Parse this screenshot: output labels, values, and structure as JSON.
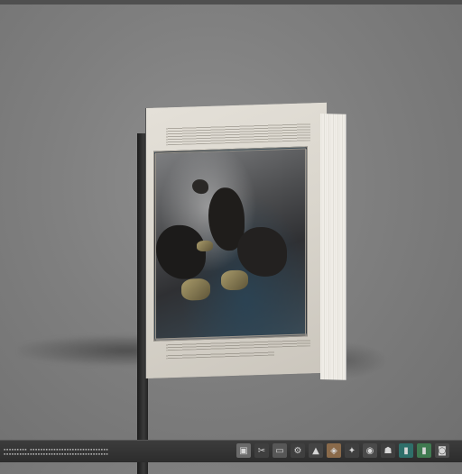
{
  "taskbar": {
    "status_line_1": "▪▪▪▪▪▪▪▪▪ ▪▪▪▪▪▪▪▪▪▪▪▪▪▪▪▪▪▪▪▪▪▪▪▪▪▪▪▪▪▪",
    "status_line_2": "▪▪▪▪▪▪▪▪▪▪▪▪▪▪▪▪▪▪▪▪▪▪▪▪▪▪▪▪▪▪▪▪▪▪▪▪▪▪▪▪",
    "icons": [
      {
        "name": "image-icon",
        "glyph": "▣",
        "color": "#6a6a6a"
      },
      {
        "name": "scissors-icon",
        "glyph": "✂",
        "color": "#3f3f3f"
      },
      {
        "name": "window-icon",
        "glyph": "▭",
        "color": "#575757"
      },
      {
        "name": "tools-icon",
        "glyph": "⚙",
        "color": "#3f3f3f"
      },
      {
        "name": "stamp-icon",
        "glyph": "▲",
        "color": "#444444"
      },
      {
        "name": "photo-icon",
        "glyph": "◈",
        "color": "#8a6a4a"
      },
      {
        "name": "bird-icon",
        "glyph": "✦",
        "color": "#3f3f3f"
      },
      {
        "name": "camera-icon",
        "glyph": "◉",
        "color": "#4a4a4a"
      },
      {
        "name": "user-icon",
        "glyph": "☗",
        "color": "#3f3f3f"
      },
      {
        "name": "app-teal-icon",
        "glyph": "▮",
        "color": "#2f6f6a"
      },
      {
        "name": "app-green-icon",
        "glyph": "▮",
        "color": "#3f7a50"
      },
      {
        "name": "screenshot-icon",
        "glyph": "◙",
        "color": "#4a4a4a"
      }
    ]
  },
  "colors": {
    "background": "#808080",
    "taskbar": "#2f2f2f"
  }
}
